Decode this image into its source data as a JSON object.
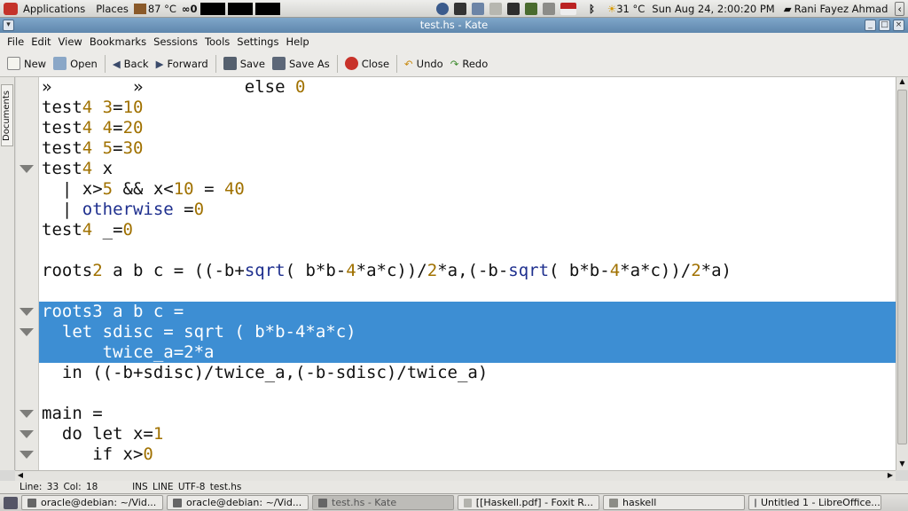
{
  "panel": {
    "applications": "Applications",
    "places": "Places",
    "temp_cpu": "87 °C",
    "weather": "31 °C",
    "clock": "Sun Aug 24,  2:00:20 PM",
    "user": "Rani Fayez Ahmad"
  },
  "window": {
    "title": "test.hs - Kate"
  },
  "menu": [
    "File",
    "Edit",
    "View",
    "Bookmarks",
    "Sessions",
    "Tools",
    "Settings",
    "Help"
  ],
  "toolbar": {
    "new": "New",
    "open": "Open",
    "back": "Back",
    "forward": "Forward",
    "save": "Save",
    "save_as": "Save As",
    "close": "Close",
    "undo": "Undo",
    "redo": "Redo"
  },
  "sidebar": {
    "documents": "Documents"
  },
  "code": [
    {
      "text": "»        »          else 0",
      "selected": false,
      "fold": false
    },
    {
      "text": "test4 3=10",
      "selected": false,
      "fold": false
    },
    {
      "text": "test4 4=20",
      "selected": false,
      "fold": false
    },
    {
      "text": "test4 5=30",
      "selected": false,
      "fold": false
    },
    {
      "text": "test4 x",
      "selected": false,
      "fold": true
    },
    {
      "text": "  | x>5 && x<10 = 40",
      "selected": false,
      "fold": false
    },
    {
      "text": "  | otherwise =0",
      "selected": false,
      "fold": false
    },
    {
      "text": "test4 _=0",
      "selected": false,
      "fold": false
    },
    {
      "text": "",
      "selected": false,
      "fold": false
    },
    {
      "text": "roots2 a b c = ((-b+sqrt( b*b-4*a*c))/2*a,(-b-sqrt( b*b-4*a*c))/2*a)",
      "selected": false,
      "fold": false
    },
    {
      "text": "",
      "selected": false,
      "fold": false
    },
    {
      "text": "roots3 a b c =",
      "selected": true,
      "fold": true
    },
    {
      "text": "  let sdisc = sqrt ( b*b-4*a*c)",
      "selected": true,
      "fold": true
    },
    {
      "text": "      twice_a=2*a",
      "selected": true,
      "fold": false
    },
    {
      "text": "  in ((-b+sdisc)/twice_a,(-b-sdisc)/twice_a)",
      "selected": false,
      "fold": false
    },
    {
      "text": "",
      "selected": false,
      "fold": false
    },
    {
      "text": "main =",
      "selected": false,
      "fold": true
    },
    {
      "text": "  do let x=1",
      "selected": false,
      "fold": true
    },
    {
      "text": "     if x>0",
      "selected": false,
      "fold": true
    }
  ],
  "status": {
    "position": "Line: 33 Col: 18",
    "mode": "INS",
    "sel": "LINE",
    "encoding": "UTF-8",
    "file": "test.hs"
  },
  "taskbar": [
    {
      "label": "oracle@debian: ~/Vid...",
      "active": false
    },
    {
      "label": "oracle@debian: ~/Vid...",
      "active": false
    },
    {
      "label": "test.hs - Kate",
      "active": true
    },
    {
      "label": "[[Haskell.pdf] - Foxit R...",
      "active": false
    },
    {
      "label": "haskell",
      "active": false
    },
    {
      "label": "Untitled 1 - LibreOffice...",
      "active": false
    }
  ],
  "colors": {
    "selection": "#3d8ed3",
    "titlebar": "#6f97bd",
    "keyword": "#111111",
    "number": "#a07100",
    "operator": "#1e2f8e"
  }
}
